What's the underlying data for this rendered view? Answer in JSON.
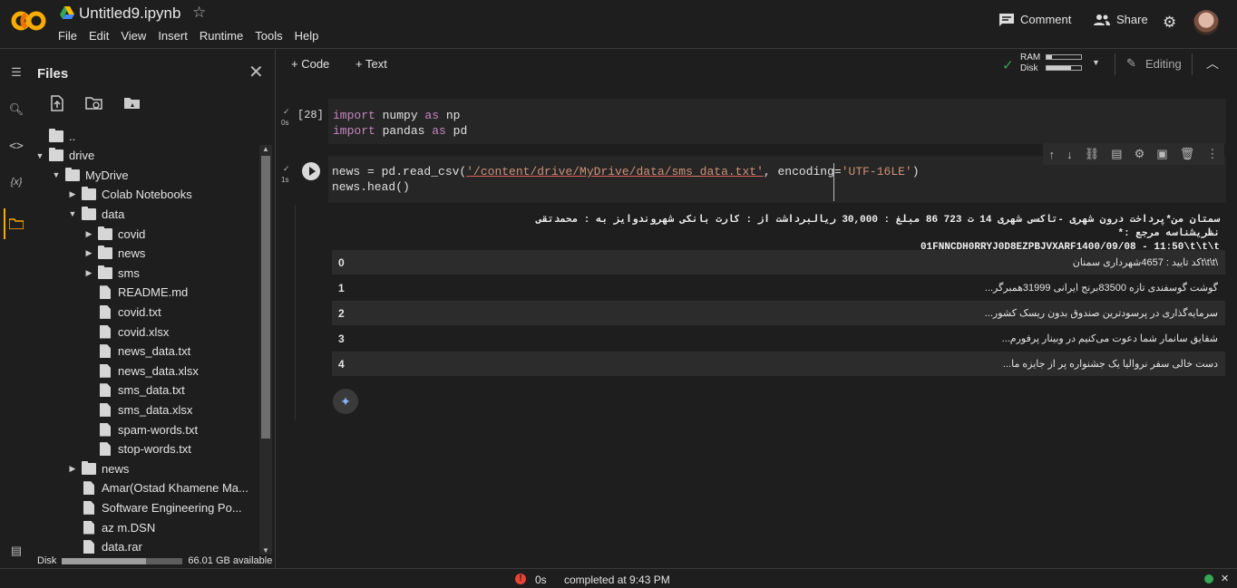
{
  "app": {
    "title": "Untitled9.ipynb"
  },
  "menu": [
    "File",
    "Edit",
    "View",
    "Insert",
    "Runtime",
    "Tools",
    "Help"
  ],
  "topright": {
    "comment": "Comment",
    "share": "Share"
  },
  "toolbar": {
    "code": "+ Code",
    "text": "+ Text",
    "ram": "RAM",
    "disk": "Disk",
    "editing": "Editing"
  },
  "sidebar": {
    "title": "Files",
    "disk_label": "Disk",
    "disk_available": "66.01 GB available",
    "disk_used_fraction": 0.7
  },
  "tree": [
    {
      "label": "..",
      "kind": "folder-up",
      "depth": 0,
      "caret": ""
    },
    {
      "label": "drive",
      "kind": "folder",
      "depth": 0,
      "caret": "down"
    },
    {
      "label": "MyDrive",
      "kind": "folder",
      "depth": 1,
      "caret": "down"
    },
    {
      "label": "Colab Notebooks",
      "kind": "folder",
      "depth": 2,
      "caret": "right"
    },
    {
      "label": "data",
      "kind": "folder",
      "depth": 2,
      "caret": "down"
    },
    {
      "label": "covid",
      "kind": "folder",
      "depth": 3,
      "caret": "right"
    },
    {
      "label": "news",
      "kind": "folder",
      "depth": 3,
      "caret": "right"
    },
    {
      "label": "sms",
      "kind": "folder",
      "depth": 3,
      "caret": "right"
    },
    {
      "label": "README.md",
      "kind": "file",
      "depth": 3,
      "caret": ""
    },
    {
      "label": "covid.txt",
      "kind": "file",
      "depth": 3,
      "caret": ""
    },
    {
      "label": "covid.xlsx",
      "kind": "file",
      "depth": 3,
      "caret": ""
    },
    {
      "label": "news_data.txt",
      "kind": "file",
      "depth": 3,
      "caret": ""
    },
    {
      "label": "news_data.xlsx",
      "kind": "file",
      "depth": 3,
      "caret": ""
    },
    {
      "label": "sms_data.txt",
      "kind": "file",
      "depth": 3,
      "caret": ""
    },
    {
      "label": "sms_data.xlsx",
      "kind": "file",
      "depth": 3,
      "caret": ""
    },
    {
      "label": "spam-words.txt",
      "kind": "file",
      "depth": 3,
      "caret": ""
    },
    {
      "label": "stop-words.txt",
      "kind": "file",
      "depth": 3,
      "caret": ""
    },
    {
      "label": "news",
      "kind": "folder",
      "depth": 2,
      "caret": "right"
    },
    {
      "label": "Amar(Ostad Khamene Ma...",
      "kind": "file",
      "depth": 2,
      "caret": ""
    },
    {
      "label": "Software Engineering Po...",
      "kind": "file",
      "depth": 2,
      "caret": ""
    },
    {
      "label": "az m.DSN",
      "kind": "file",
      "depth": 2,
      "caret": ""
    },
    {
      "label": "data.rar",
      "kind": "file",
      "depth": 2,
      "caret": ""
    }
  ],
  "cell1": {
    "exec": "[28]",
    "time": "0s",
    "line1_kw": "import",
    "line1_mod": " numpy ",
    "line1_as": "as",
    "line1_alias": " np",
    "line2_kw": "import",
    "line2_mod": " pandas ",
    "line2_as": "as",
    "line2_alias": " pd"
  },
  "cell2": {
    "time": "1s",
    "l1a": "news = pd.read_csv(",
    "l1s": "'/content/drive/MyDrive/data/sms_data.txt'",
    "l1b": ", encoding=",
    "l1e": "'UTF-16LE'",
    "l1c": ")",
    "line2": "news.head()"
  },
  "output": {
    "header1": "سمتان من*پرداخت درون شهری -تاکسی شهری 14 ت 723 86 مبلغ : 30,000 ریالبرداشت از : کارت بانکی شهروندوایز به : محمدتقی نظریشناسه مرجع :*",
    "header2": "01FNNCDH0RRYJ0D8EZPBJVXARF1400/09/08 - 11:50\\t\\t\\t",
    "rows": [
      {
        "index": "0",
        "value": "\\t\\t\\tکد تایید : 4657شهرداری سمنان"
      },
      {
        "index": "1",
        "value": "گوشت گوسفندی تازه 83500برنج ایرانی 31999همبرگر..."
      },
      {
        "index": "2",
        "value": "سرمایه‌گذاری در پرسودترین صندوق بدون ریسک کشور..."
      },
      {
        "index": "3",
        "value": "شقایق سانمار شما دعوت می‌کنیم در وبینار پرفورم..."
      },
      {
        "index": "4",
        "value": "دست خالی سفر نروالیا یک جشنواره پر از جایزه ما..."
      }
    ]
  },
  "status": {
    "seconds": "0s",
    "text": "completed at 9:43 PM"
  },
  "colors": {
    "accent": "#f9ab00",
    "keyword": "#c586c0",
    "string": "#ce9178",
    "ok": "#34a853",
    "error": "#ea4335"
  }
}
